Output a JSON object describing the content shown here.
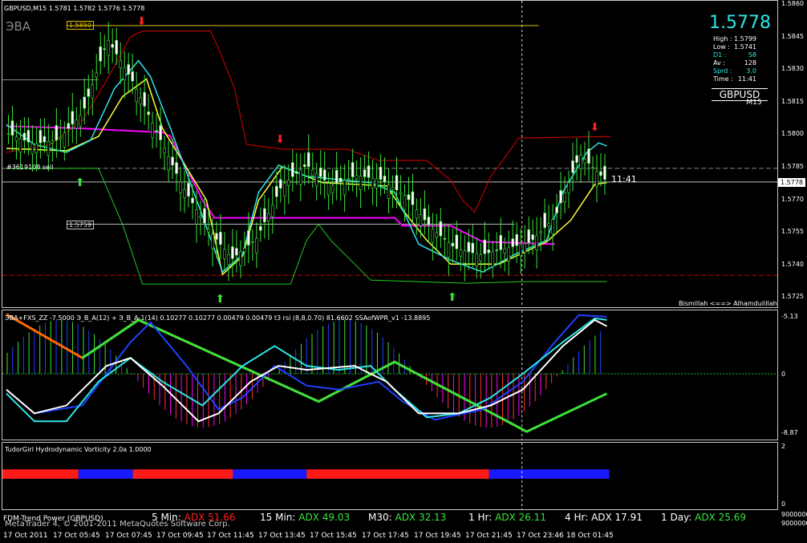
{
  "header": {
    "symbol_quote": "GBPUSD,M15  1.5781 1.5782 1.5776 1.5778",
    "eba_label": "ЭBA"
  },
  "price_panel": {
    "bid": "1.5778",
    "stats": [
      {
        "key": "High :",
        "value": "1.5799",
        "color": "#ffffff"
      },
      {
        "key": "Low :",
        "value": "1.5741",
        "color": "#ffffff"
      },
      {
        "key": "D1 :",
        "value": "58",
        "color": "#2ee6e6"
      },
      {
        "key": "Av :",
        "value": "128",
        "color": "#ffffff"
      },
      {
        "key": "Sprd :",
        "value": "3.0",
        "color": "#2ee6e6"
      },
      {
        "key": "Time :",
        "value": "11:41",
        "color": "#ffffff"
      }
    ],
    "symbol": "GBPUSD",
    "timeframe": "M15"
  },
  "main_chart": {
    "price_axis": [
      "1.5860",
      "1.5845",
      "1.5830",
      "1.5815",
      "1.5800",
      "1.5785",
      "1.5770",
      "1.5755",
      "1.5740",
      "1.5725"
    ],
    "current_price_box": "1.5778",
    "level_1585": "1.5850",
    "level_1575": "1.5759",
    "order_label": "#3619108 sell",
    "time_marker": "11:41",
    "footer_text": "Bismillah <==> Alhamdulillah"
  },
  "oscillator": {
    "header": "ЭBA+FXS_ZZ -7.5000  Э_B_A(12) + Э_B_A-1(14) 0.10277 0.10277 0.00479 0.00479  t3 rsi (8,8,0.70) 81.6602  SSAofWPR_v1 -13.8895",
    "axis": [
      "-5.13",
      "0",
      "-8.87"
    ]
  },
  "vorticity": {
    "header": "TudorGirl Hydrodynamic Vorticity 2.0a 1.0000",
    "axis": [
      "2",
      "0"
    ]
  },
  "adx": {
    "items": [
      {
        "label": "FDM-Trend Power (GBPUSD)",
        "value": "",
        "value_color": "#ffffff"
      },
      {
        "label": "5 Min:",
        "value": "ADX 51.66",
        "value_color": "#ff2020"
      },
      {
        "label": "15 Min:",
        "value": "ADX 49.03",
        "value_color": "#3ae33a"
      },
      {
        "label": "M30:",
        "value": "ADX 32.13",
        "value_color": "#3ae33a"
      },
      {
        "label": "1 Hr:",
        "value": "ADX 26.11",
        "value_color": "#3ae33a"
      },
      {
        "label": "4 Hr:",
        "value": "ADX 17.91",
        "value_color": "#ffffff"
      },
      {
        "label": "1 Day:",
        "value": "ADX 25.69",
        "value_color": "#3ae33a"
      }
    ],
    "copyright": "MetaTrader 4, © 2001-2011 MetaQuotes Software Corp."
  },
  "right_axis_bottom": [
    "9000000",
    "9000000"
  ],
  "time_axis": [
    "17 Oct 2011",
    "17 Oct 05:45",
    "17 Oct 07:45",
    "17 Oct 09:45",
    "17 Oct 11:45",
    "17 Oct 13:45",
    "17 Oct 15:45",
    "17 Oct 17:45",
    "17 Oct 19:45",
    "17 Oct 21:45",
    "17 Oct 23:46",
    "18 Oct 01:45"
  ],
  "colors": {
    "accent": "#2ee6e6",
    "bull": "#3ae33a",
    "bear": "#ff2020",
    "magenta": "#ff00ff",
    "yellow": "#ffff33"
  },
  "chart_data": {
    "type": "line",
    "series": [
      {
        "name": "GBPUSD close",
        "x": [
          0,
          1,
          2,
          3,
          4,
          5,
          6,
          7,
          8,
          9,
          10,
          11,
          12,
          13,
          14,
          15,
          16,
          17,
          18,
          19,
          20,
          21,
          22,
          23,
          24
        ],
        "values": [
          1.58,
          1.5795,
          1.5797,
          1.581,
          1.5845,
          1.5825,
          1.58,
          1.5775,
          1.5755,
          1.574,
          1.575,
          1.5775,
          1.5785,
          1.5775,
          1.578,
          1.5778,
          1.577,
          1.5755,
          1.5745,
          1.5742,
          1.5745,
          1.5748,
          1.576,
          1.579,
          1.5778
        ]
      }
    ],
    "ylim": [
      1.572,
      1.5862
    ]
  }
}
